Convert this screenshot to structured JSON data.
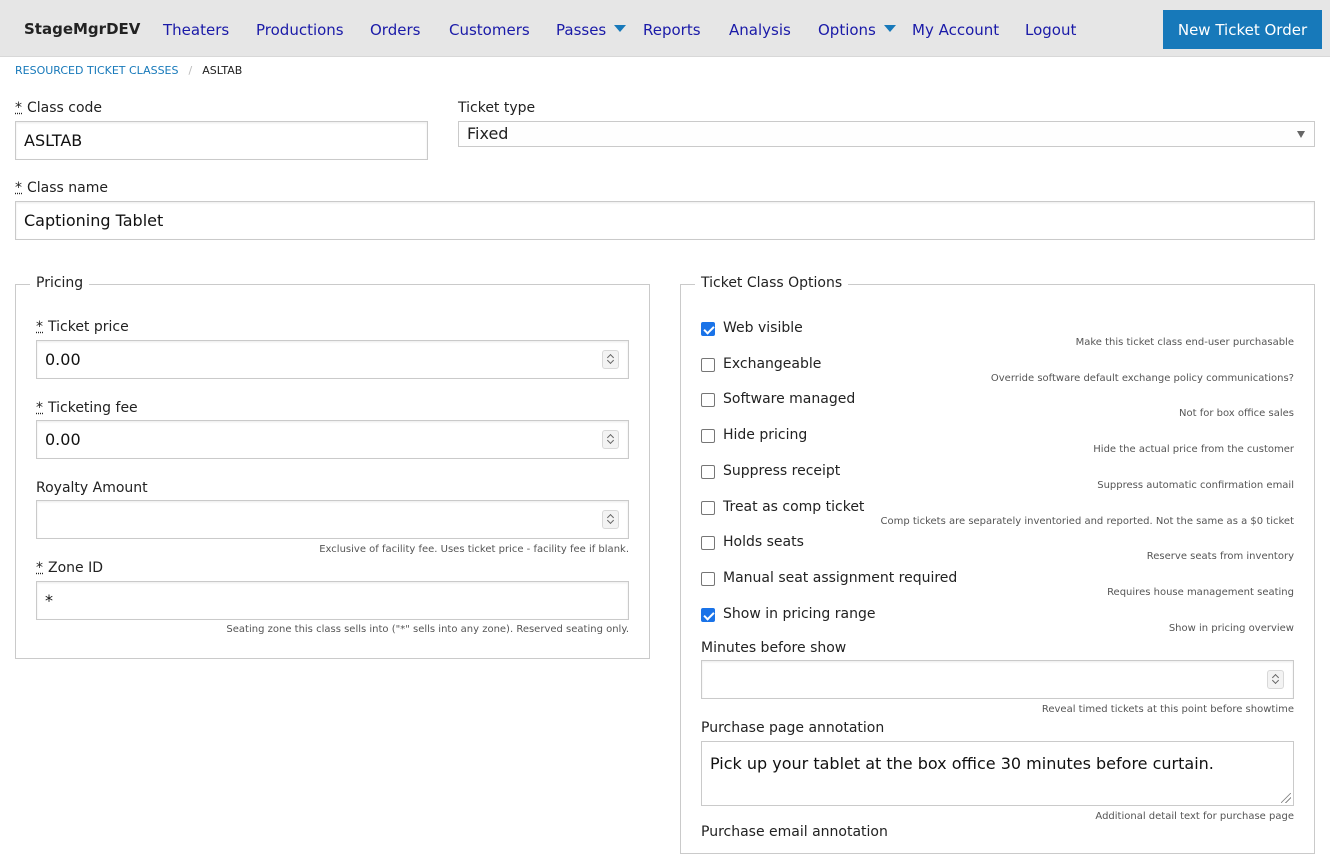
{
  "nav": {
    "brand": "StageMgrDEV",
    "links": [
      "Theaters",
      "Productions",
      "Orders",
      "Customers",
      "Passes",
      "Reports",
      "Analysis",
      "Options",
      "My Account",
      "Logout"
    ],
    "cta": "New Ticket Order"
  },
  "breadcrumb": {
    "parent": "Resourced Ticket Classes",
    "separator": "/",
    "current": "ASLTAB"
  },
  "form": {
    "required_mark": "*",
    "class_code": {
      "label": "Class code",
      "value": "ASLTAB"
    },
    "ticket_type": {
      "label": "Ticket type",
      "value": "Fixed"
    },
    "class_name": {
      "label": "Class name",
      "value": "Captioning Tablet"
    }
  },
  "pricing": {
    "legend": "Pricing",
    "ticket_price": {
      "label": "Ticket price",
      "value": "0.00"
    },
    "ticketing_fee": {
      "label": "Ticketing fee",
      "value": "0.00"
    },
    "royalty": {
      "label": "Royalty Amount",
      "value": "",
      "help": "Exclusive of facility fee. Uses ticket price - facility fee if blank."
    },
    "zone": {
      "label": "Zone ID",
      "value": "*",
      "help": "Seating zone this class sells into (\"*\" sells into any zone). Reserved seating only."
    }
  },
  "options": {
    "legend": "Ticket Class Options",
    "items": [
      {
        "label": "Web visible",
        "help": "Make this ticket class end-user purchasable",
        "checked": true
      },
      {
        "label": "Exchangeable",
        "help": "Override software default exchange policy communications?",
        "checked": false
      },
      {
        "label": "Software managed",
        "help": "Not for box office sales",
        "checked": false
      },
      {
        "label": "Hide pricing",
        "help": "Hide the actual price from the customer",
        "checked": false
      },
      {
        "label": "Suppress receipt",
        "help": "Suppress automatic confirmation email",
        "checked": false
      },
      {
        "label": "Treat as comp ticket",
        "help": "Comp tickets are separately inventoried and reported. Not the same as a $0 ticket",
        "checked": false
      },
      {
        "label": "Holds seats",
        "help": "Reserve seats from inventory",
        "checked": false
      },
      {
        "label": "Manual seat assignment required",
        "help": "Requires house management seating",
        "checked": false
      },
      {
        "label": "Show in pricing range",
        "help": "Show in pricing overview",
        "checked": true
      }
    ],
    "minutes_before_show": {
      "label": "Minutes before show",
      "value": "",
      "help": "Reveal timed tickets at this point before showtime"
    },
    "purchase_page_annotation": {
      "label": "Purchase page annotation",
      "value": "Pick up your tablet at the box office 30 minutes before curtain.",
      "help": "Additional detail text for purchase page"
    },
    "purchase_email_annotation": {
      "label": "Purchase email annotation"
    }
  }
}
